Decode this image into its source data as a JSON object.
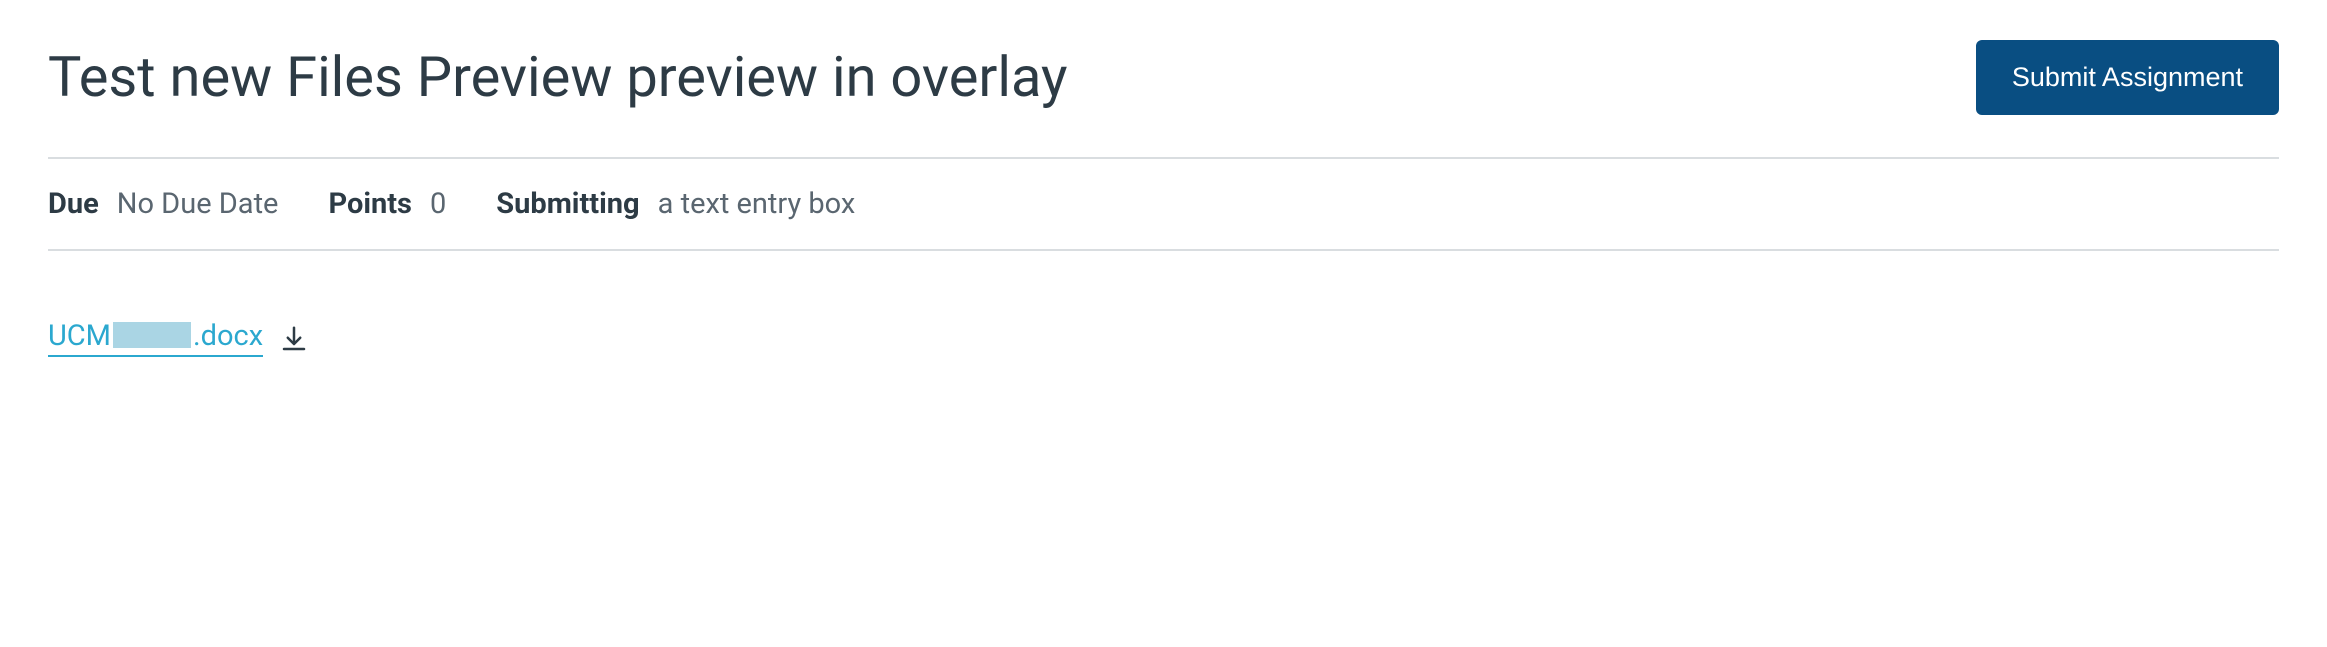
{
  "header": {
    "title": "Test new Files Preview preview in overlay",
    "submit_label": "Submit Assignment"
  },
  "meta": {
    "due_label": "Due",
    "due_value": "No Due Date",
    "points_label": "Points",
    "points_value": "0",
    "submitting_label": "Submitting",
    "submitting_value": "a text entry box"
  },
  "attachment": {
    "prefix": "UCM",
    "suffix": ".docx"
  }
}
